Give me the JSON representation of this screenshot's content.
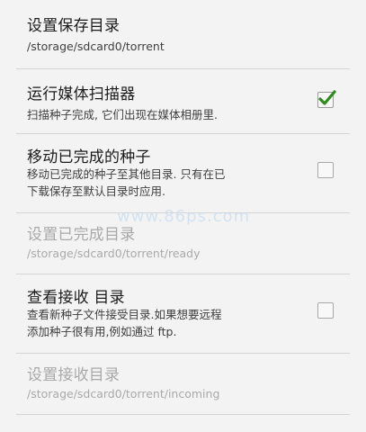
{
  "preferences": [
    {
      "title": "设置保存目录",
      "summary_lines": [
        "/storage/sdcard0/torrent"
      ],
      "enabled": true,
      "has_checkbox": false
    },
    {
      "title": "运行媒体扫描器",
      "summary_lines": [
        "扫描种子完成, 它们出现在媒体相册里."
      ],
      "enabled": true,
      "has_checkbox": true,
      "checked": true
    },
    {
      "title": "移动已完成的种子",
      "summary_lines": [
        "移动已完成的种子至其他目录. 只有在已",
        "下载保存至默认目录时应用."
      ],
      "enabled": true,
      "has_checkbox": true,
      "checked": false
    },
    {
      "title": "设置已完成目录",
      "summary_lines": [
        "/storage/sdcard0/torrent/ready"
      ],
      "enabled": false,
      "has_checkbox": false
    },
    {
      "title": "查看接收 目录",
      "summary_lines": [
        "查看新种子文件接受目录.如果想要远程",
        "添加种子很有用,例如通过 ftp."
      ],
      "enabled": true,
      "has_checkbox": true,
      "checked": false
    },
    {
      "title": "设置接收目录",
      "summary_lines": [
        "/storage/sdcard0/torrent/incoming"
      ],
      "enabled": false,
      "has_checkbox": false
    }
  ],
  "watermark": "www.86ps.com",
  "colors": {
    "background": "#f3f3f3",
    "checkmark": "#2e8b1e",
    "divider": "#d4d4d4"
  }
}
